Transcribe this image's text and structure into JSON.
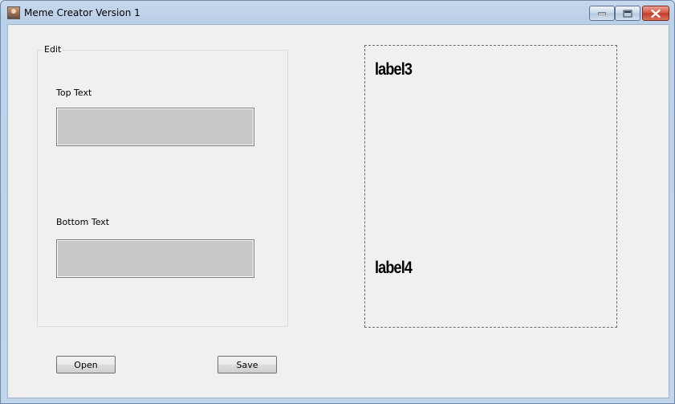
{
  "window": {
    "title": "Meme Creator Version 1",
    "icons": {
      "app": "app-icon",
      "minimize": "minimize-icon",
      "maximize": "maximize-icon",
      "close": "close-icon"
    }
  },
  "edit_group": {
    "legend": "Edit",
    "top_text": {
      "label": "Top Text",
      "value": ""
    },
    "bottom_text": {
      "label": "Bottom Text",
      "value": ""
    }
  },
  "preview": {
    "top_label": "label3",
    "bottom_label": "label4"
  },
  "buttons": {
    "open": "Open",
    "save": "Save"
  },
  "colors": {
    "textbox_fill": "#c8c8c8",
    "client_background": "#f0f0f0",
    "close_button": "#c23b24"
  }
}
